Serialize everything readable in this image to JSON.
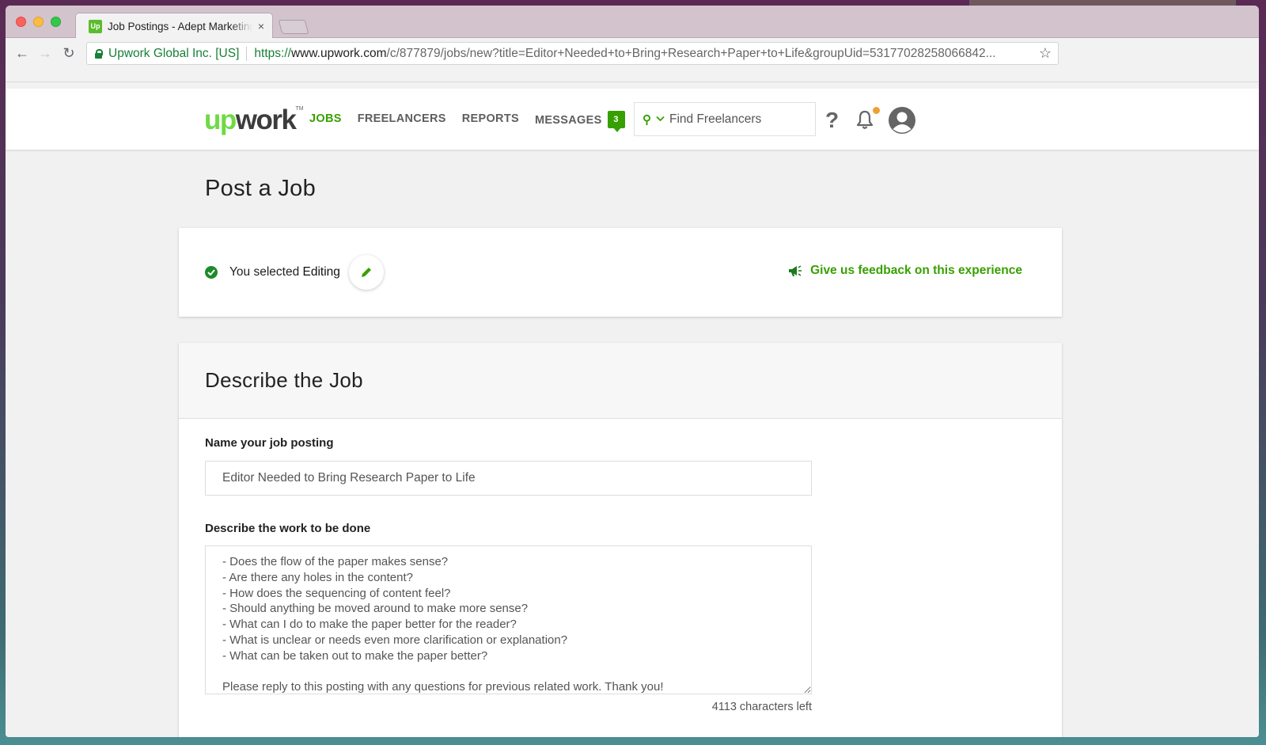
{
  "browser": {
    "tab_title": "Job Postings - Adept Marketing",
    "tab_close": "×",
    "secure_label": "Upwork Global Inc. [US]",
    "url_scheme": "https://",
    "url_host": "www.upwork.com",
    "url_path": "/c/877879/jobs/new?title=Editor+Needed+to+Bring+Research+Paper+to+Life&groupUid=53177028258066842...",
    "icons": {
      "back": "←",
      "forward": "→",
      "reload": "↻",
      "star": "☆"
    }
  },
  "header": {
    "logo_up": "up",
    "logo_work": "work",
    "logo_tm": "TM",
    "nav": [
      {
        "label": "JOBS",
        "active": true
      },
      {
        "label": "FREELANCERS"
      },
      {
        "label": "REPORTS"
      },
      {
        "label": "MESSAGES"
      }
    ],
    "messages_count": "3",
    "search_placeholder": "Find Freelancers",
    "help_label": "?",
    "has_notification": true,
    "accent_color": "#37a000"
  },
  "page": {
    "title": "Post a Job"
  },
  "selection": {
    "prefix": "You selected",
    "category": "Editing",
    "feedback_link": "Give us feedback on this experience"
  },
  "describe": {
    "heading": "Describe the Job",
    "name_label": "Name your job posting",
    "name_value": "Editor Needed to Bring Research Paper to Life",
    "desc_label": "Describe the work to be done",
    "desc_value": "- Does the flow of the paper makes sense?\n- Are there any holes in the content?\n- How does the sequencing of content feel?\n- Should anything be moved around to make more sense?\n- What can I do to make the paper better for the reader?\n- What is unclear or needs even more clarification or explanation?\n- What can be taken out to make the paper better?\n\nPlease reply to this posting with any questions for previous related work. Thank you!",
    "chars_left": "4113 characters left"
  }
}
